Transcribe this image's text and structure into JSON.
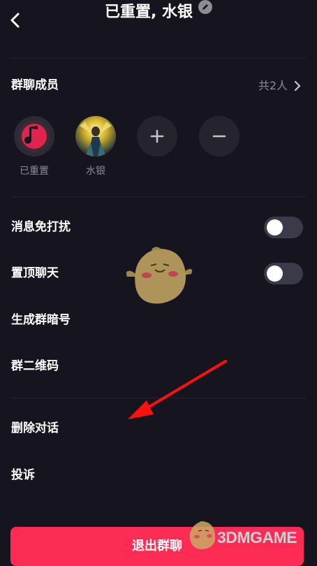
{
  "header": {
    "title": "已重置, 水银"
  },
  "members_section": {
    "label": "群聊成员",
    "count": "共2人",
    "members": [
      {
        "name": "已重置"
      },
      {
        "name": "水银"
      }
    ]
  },
  "settings": {
    "mute_label": "消息免打扰",
    "mute_on": false,
    "pin_label": "置顶聊天",
    "pin_on": false,
    "code_label": "生成群暗号",
    "qr_label": "群二维码",
    "delete_label": "删除对话",
    "report_label": "投诉"
  },
  "exit_button_label": "退出群聊",
  "watermark": "3DMGAME",
  "colors": {
    "background": "#15141f",
    "accent": "#fd2c55",
    "annotation_arrow": "#ff1010"
  }
}
